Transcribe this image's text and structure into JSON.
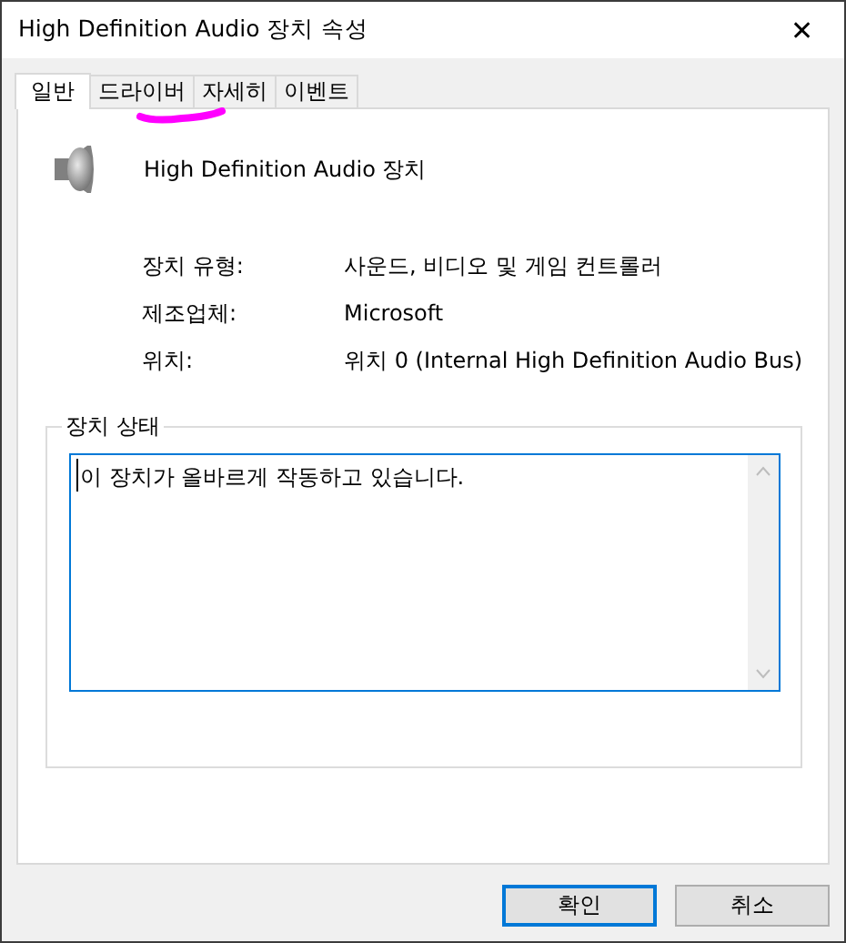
{
  "window": {
    "title": "High Definition Audio 장치 속성",
    "close": "✕"
  },
  "tabs": [
    {
      "label": "일반",
      "selected": true
    },
    {
      "label": "드라이버",
      "selected": false
    },
    {
      "label": "자세히",
      "selected": false
    },
    {
      "label": "이벤트",
      "selected": false
    }
  ],
  "device": {
    "name": "High Definition Audio 장치"
  },
  "properties": [
    {
      "label": "장치 유형:",
      "value": "사운드, 비디오 및 게임 컨트롤러"
    },
    {
      "label": "제조업체:",
      "value": "Microsoft"
    },
    {
      "label": "위치:",
      "value": "위치 0 (Internal High Definition Audio Bus)"
    }
  ],
  "status": {
    "title": "장치 상태",
    "text": "이 장치가 올바르게 작동하고 있습니다."
  },
  "buttons": [
    {
      "label": "확인",
      "default": true
    },
    {
      "label": "취소",
      "default": false
    }
  ]
}
